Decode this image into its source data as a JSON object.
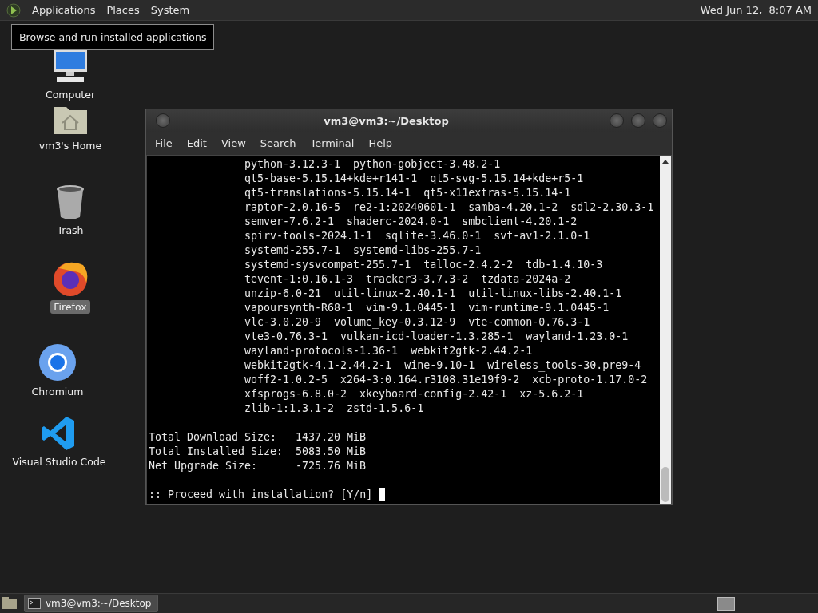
{
  "top_panel": {
    "menus": [
      "Applications",
      "Places",
      "System"
    ],
    "clock": "Wed Jun 12,  8:07 AM"
  },
  "tooltip": "Browse and run installed applications",
  "desktop_icons": [
    {
      "kind": "computer",
      "label": "Computer",
      "selected": false
    },
    {
      "kind": "home",
      "label": "vm3's Home",
      "selected": false
    },
    {
      "kind": "trash",
      "label": "Trash",
      "selected": false
    },
    {
      "kind": "firefox",
      "label": "Firefox",
      "selected": true
    },
    {
      "kind": "chromium",
      "label": "Chromium",
      "selected": false
    },
    {
      "kind": "vscode",
      "label": "Visual Studio Code",
      "selected": false
    }
  ],
  "terminal": {
    "title": "vm3@vm3:~/Desktop",
    "menus": [
      "File",
      "Edit",
      "View",
      "Search",
      "Terminal",
      "Help"
    ],
    "package_lines": [
      "python-3.12.3-1  python-gobject-3.48.2-1",
      "qt5-base-5.15.14+kde+r141-1  qt5-svg-5.15.14+kde+r5-1",
      "qt5-translations-5.15.14-1  qt5-x11extras-5.15.14-1",
      "raptor-2.0.16-5  re2-1:20240601-1  samba-4.20.1-2  sdl2-2.30.3-1",
      "semver-7.6.2-1  shaderc-2024.0-1  smbclient-4.20.1-2",
      "spirv-tools-2024.1-1  sqlite-3.46.0-1  svt-av1-2.1.0-1",
      "systemd-255.7-1  systemd-libs-255.7-1",
      "systemd-sysvcompat-255.7-1  talloc-2.4.2-2  tdb-1.4.10-3",
      "tevent-1:0.16.1-3  tracker3-3.7.3-2  tzdata-2024a-2",
      "unzip-6.0-21  util-linux-2.40.1-1  util-linux-libs-2.40.1-1",
      "vapoursynth-R68-1  vim-9.1.0445-1  vim-runtime-9.1.0445-1",
      "vlc-3.0.20-9  volume_key-0.3.12-9  vte-common-0.76.3-1",
      "vte3-0.76.3-1  vulkan-icd-loader-1.3.285-1  wayland-1.23.0-1",
      "wayland-protocols-1.36-1  webkit2gtk-2.44.2-1",
      "webkit2gtk-4.1-2.44.2-1  wine-9.10-1  wireless_tools-30.pre9-4",
      "woff2-1.0.2-5  x264-3:0.164.r3108.31e19f9-2  xcb-proto-1.17.0-2",
      "xfsprogs-6.8.0-2  xkeyboard-config-2.42-1  xz-5.6.2-1",
      "zlib-1:1.3.1-2  zstd-1.5.6-1"
    ],
    "summary": [
      {
        "label": "Total Download Size:",
        "value": "1437.20 MiB"
      },
      {
        "label": "Total Installed Size:",
        "value": "5083.50 MiB"
      },
      {
        "label": "Net Upgrade Size:",
        "value": "-725.76 MiB"
      }
    ],
    "prompt": ":: Proceed with installation? [Y/n]"
  },
  "taskbar": {
    "tasks": [
      {
        "label": "vm3@vm3:~/Desktop",
        "selected": true
      }
    ]
  }
}
